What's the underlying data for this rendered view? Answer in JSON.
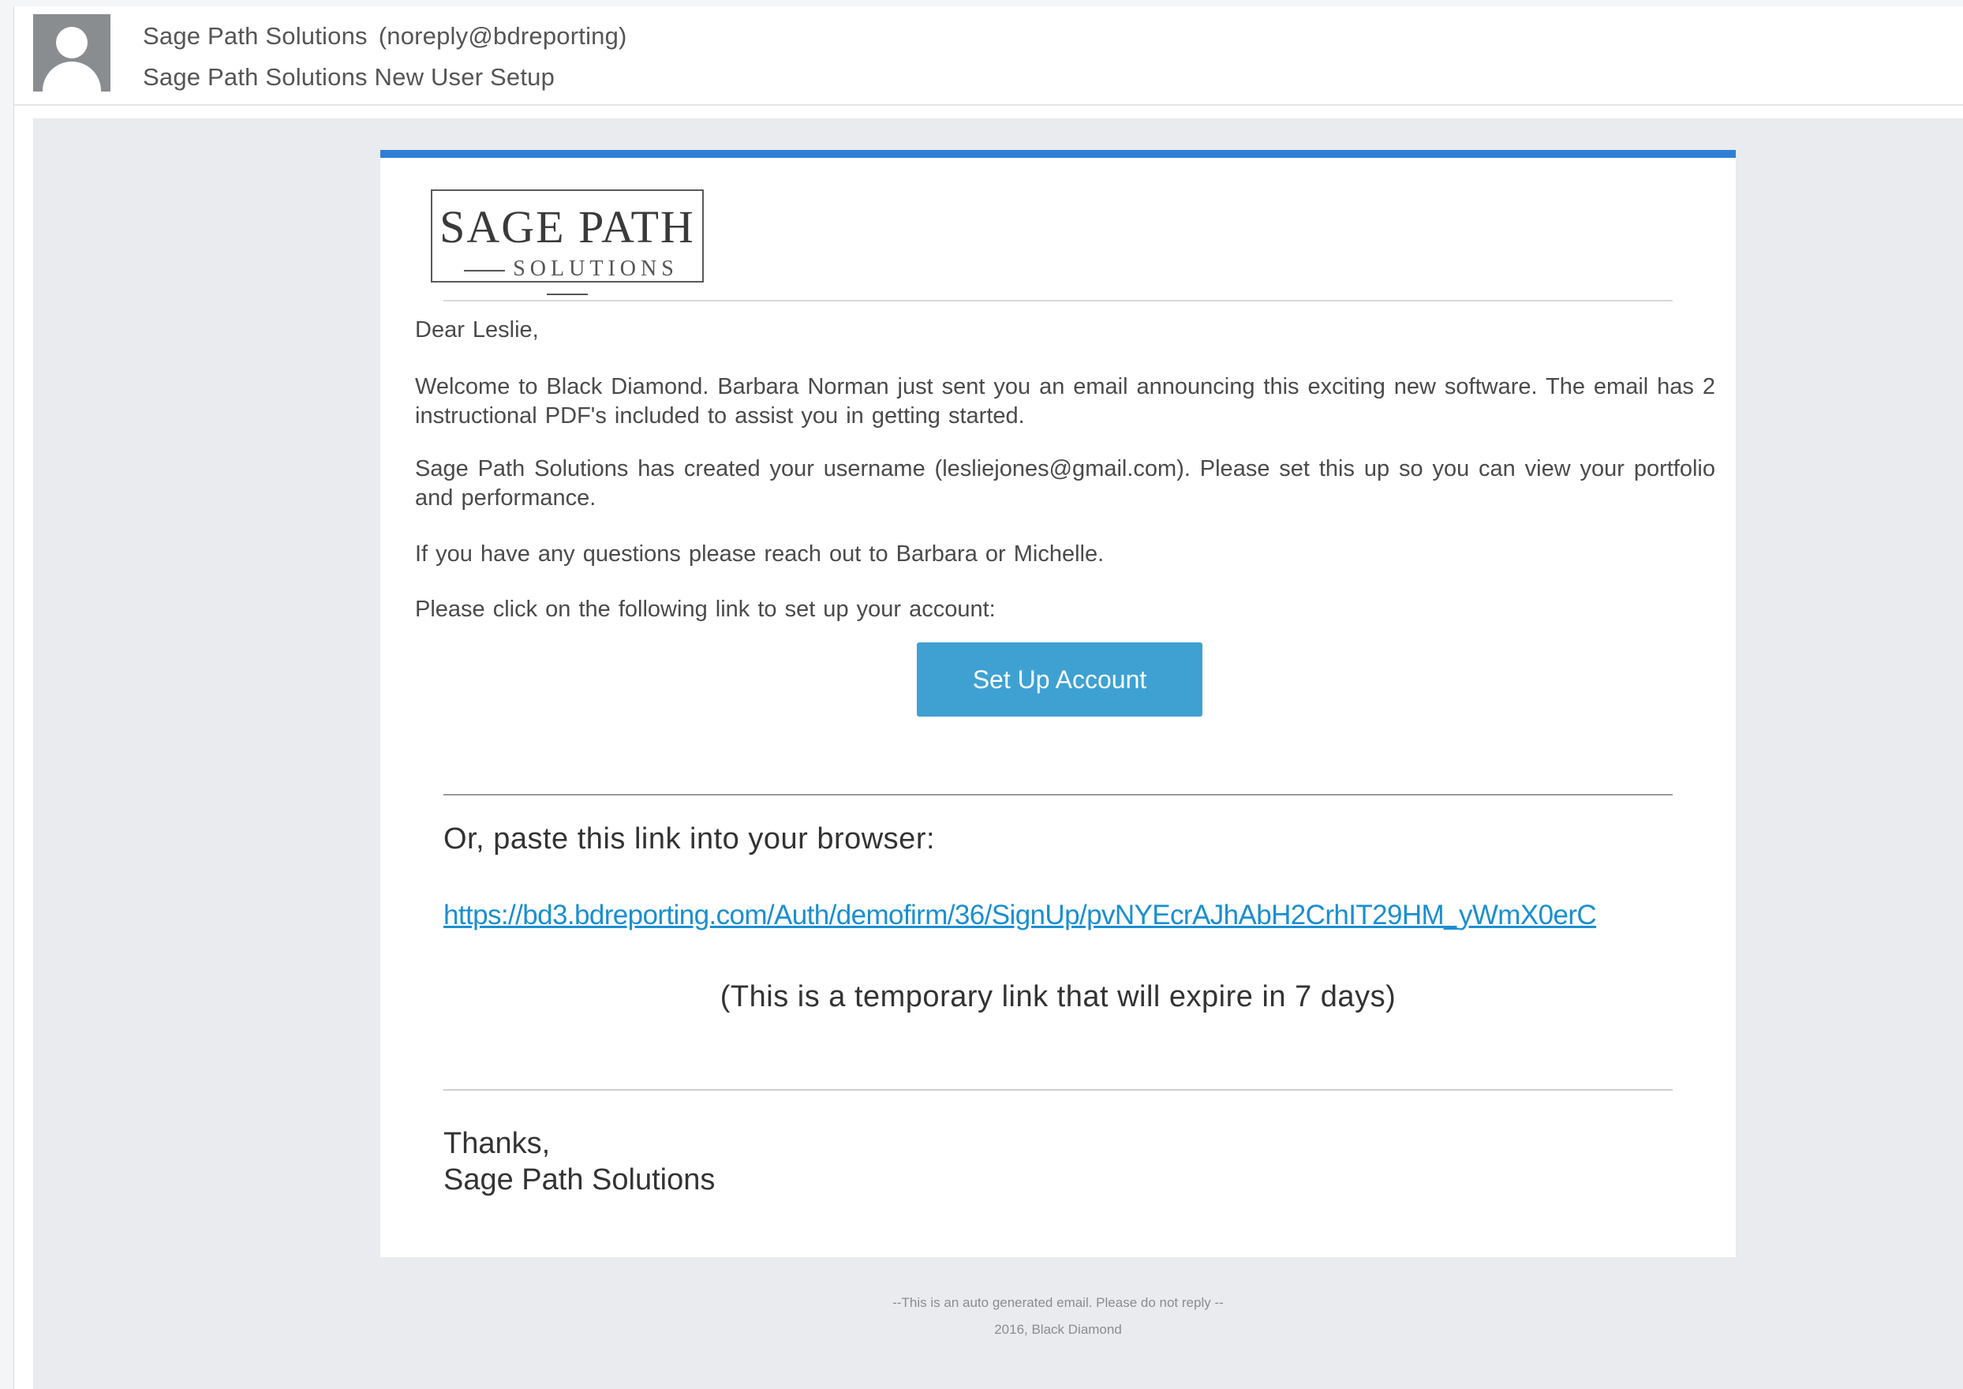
{
  "header": {
    "sender_name": "Sage Path Solutions",
    "sender_email": "(noreply@bdreporting)",
    "subject": "Sage Path Solutions New User Setup"
  },
  "logo": {
    "title": "SAGE PATH",
    "subtitle": "SOLUTIONS"
  },
  "body": {
    "greeting": "Dear Leslie,",
    "paragraph_1": "Welcome to Black Diamond.  Barbara Norman just sent you an email announcing this exciting new software. The email has 2 instructional PDF's included to assist you in getting started.",
    "paragraph_2": "Sage Path Solutions has created your username (lesliejones@gmail.com).  Please set this up so you can view your portfolio and performance.",
    "paragraph_3": "If you have any questions please reach out to Barbara or Michelle.",
    "paragraph_4": "Please click on the following link to set up your account:",
    "cta_label": "Set Up Account",
    "paste_label": "Or, paste this link into your browser:",
    "paste_link": "https://bd3.bdreporting.com/Auth/demofirm/36/SignUp/pvNYEcrAJhAbH2CrhIT29HM_yWmX0erC",
    "expire_note": "(This is a temporary link that will expire in 7 days)",
    "signoff_1": "Thanks,",
    "signoff_2": "Sage Path Solutions"
  },
  "footer": {
    "line_1": "--This is an auto generated email. Please do not reply --",
    "line_2": "2016, Black Diamond"
  },
  "colors": {
    "accent_bar": "#2f7fd6",
    "button": "#3ea1d2",
    "link": "#1a8fd0",
    "body_background": "#e9ebee"
  },
  "icons": {
    "avatar": "default-user-avatar-icon"
  }
}
